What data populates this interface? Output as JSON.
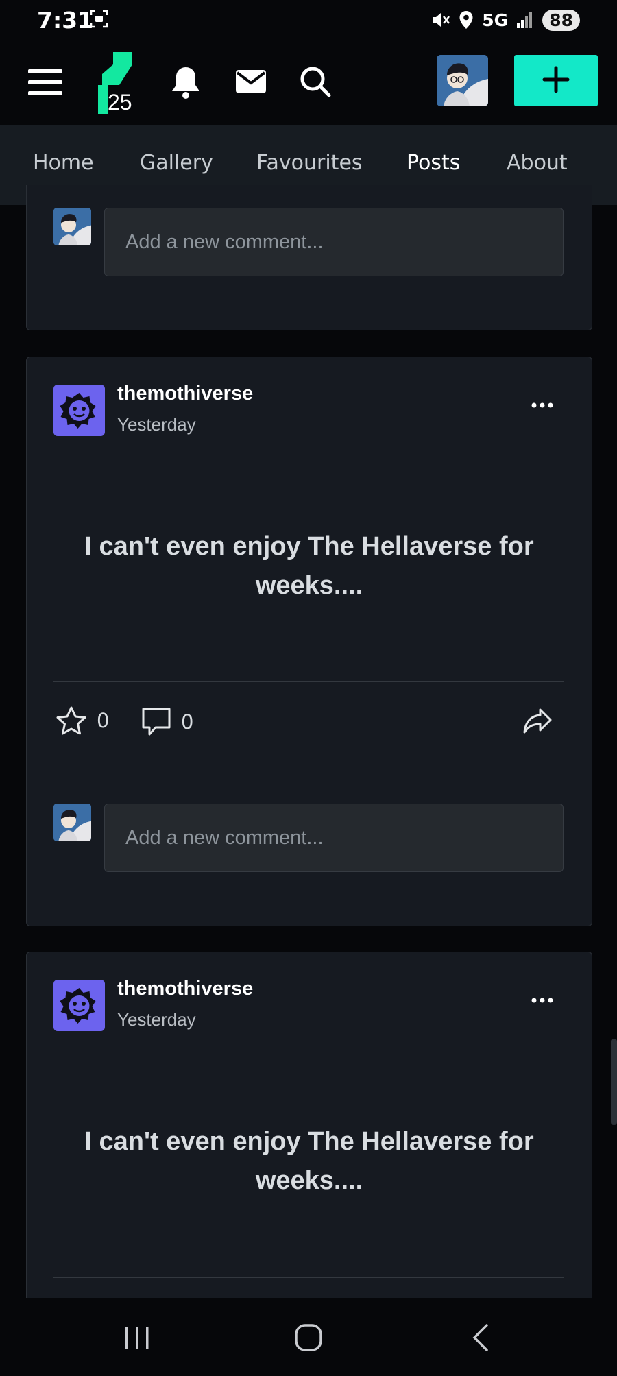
{
  "status_bar": {
    "time": "7:31",
    "network": "5G",
    "battery": "88",
    "icons": [
      "screenshot-icon",
      "mute-icon",
      "location-icon",
      "signal-icon"
    ]
  },
  "app_bar": {
    "logo_badge": "25",
    "icons": [
      "menu-icon",
      "notifications-icon",
      "messages-icon",
      "search-icon",
      "create-icon"
    ],
    "accent_color": "#13e8c8"
  },
  "tabs": [
    {
      "label": "Home",
      "active": false
    },
    {
      "label": "Gallery",
      "active": false
    },
    {
      "label": "Favourites",
      "active": false
    },
    {
      "label": "Posts",
      "active": true
    },
    {
      "label": "About",
      "active": false
    }
  ],
  "top_comment": {
    "placeholder": "Add a new comment..."
  },
  "posts": [
    {
      "author": "themothiverse",
      "time": "Yesterday",
      "text": "I can't even enjoy The Hellaverse for weeks....",
      "favourites": "0",
      "comments": "0",
      "comment_placeholder": "Add a new comment..."
    },
    {
      "author": "themothiverse",
      "time": "Yesterday",
      "text": "I can't even enjoy The Hellaverse for weeks...."
    }
  ]
}
